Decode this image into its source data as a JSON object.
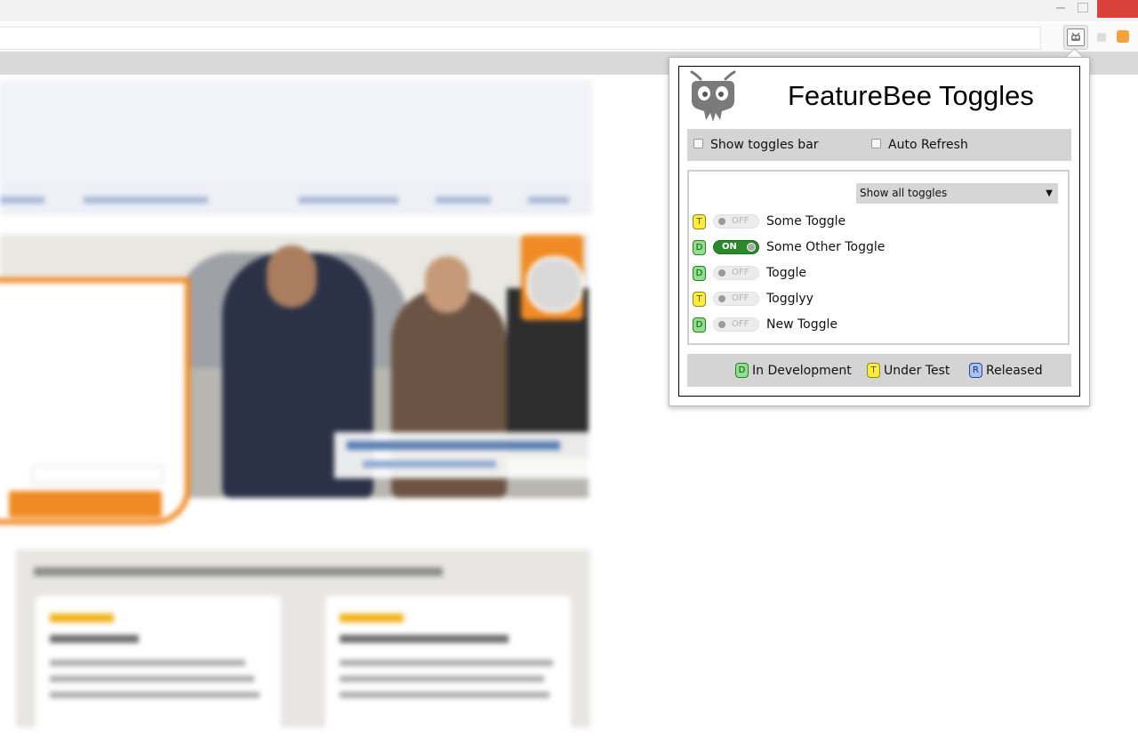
{
  "popup": {
    "title": "FeatureBee Toggles",
    "options": {
      "show_toggles_bar": {
        "label": "Show toggles bar",
        "checked": false
      },
      "auto_refresh": {
        "label": "Auto Refresh",
        "checked": false
      }
    },
    "filter": {
      "selected": "Show all toggles"
    },
    "toggles": [
      {
        "status": "T",
        "state": "OFF",
        "name": "Some Toggle"
      },
      {
        "status": "D",
        "state": "ON",
        "name": "Some Other Toggle"
      },
      {
        "status": "D",
        "state": "OFF",
        "name": "Toggle"
      },
      {
        "status": "T",
        "state": "OFF",
        "name": "Togglyy"
      },
      {
        "status": "D",
        "state": "OFF",
        "name": "New Toggle"
      }
    ],
    "legend": [
      {
        "badge": "D",
        "label": "In Development"
      },
      {
        "badge": "T",
        "label": "Under Test"
      },
      {
        "badge": "R",
        "label": "Released"
      }
    ]
  },
  "colors": {
    "dev": "#8ee08a",
    "test": "#ffeb3b",
    "released": "#a9c4f2",
    "switch_on": "#2a8a2a",
    "browser_close": "#d9413a",
    "site_accent": "#f08a24"
  },
  "icons": {
    "extension": "featurebee-logo-icon"
  }
}
